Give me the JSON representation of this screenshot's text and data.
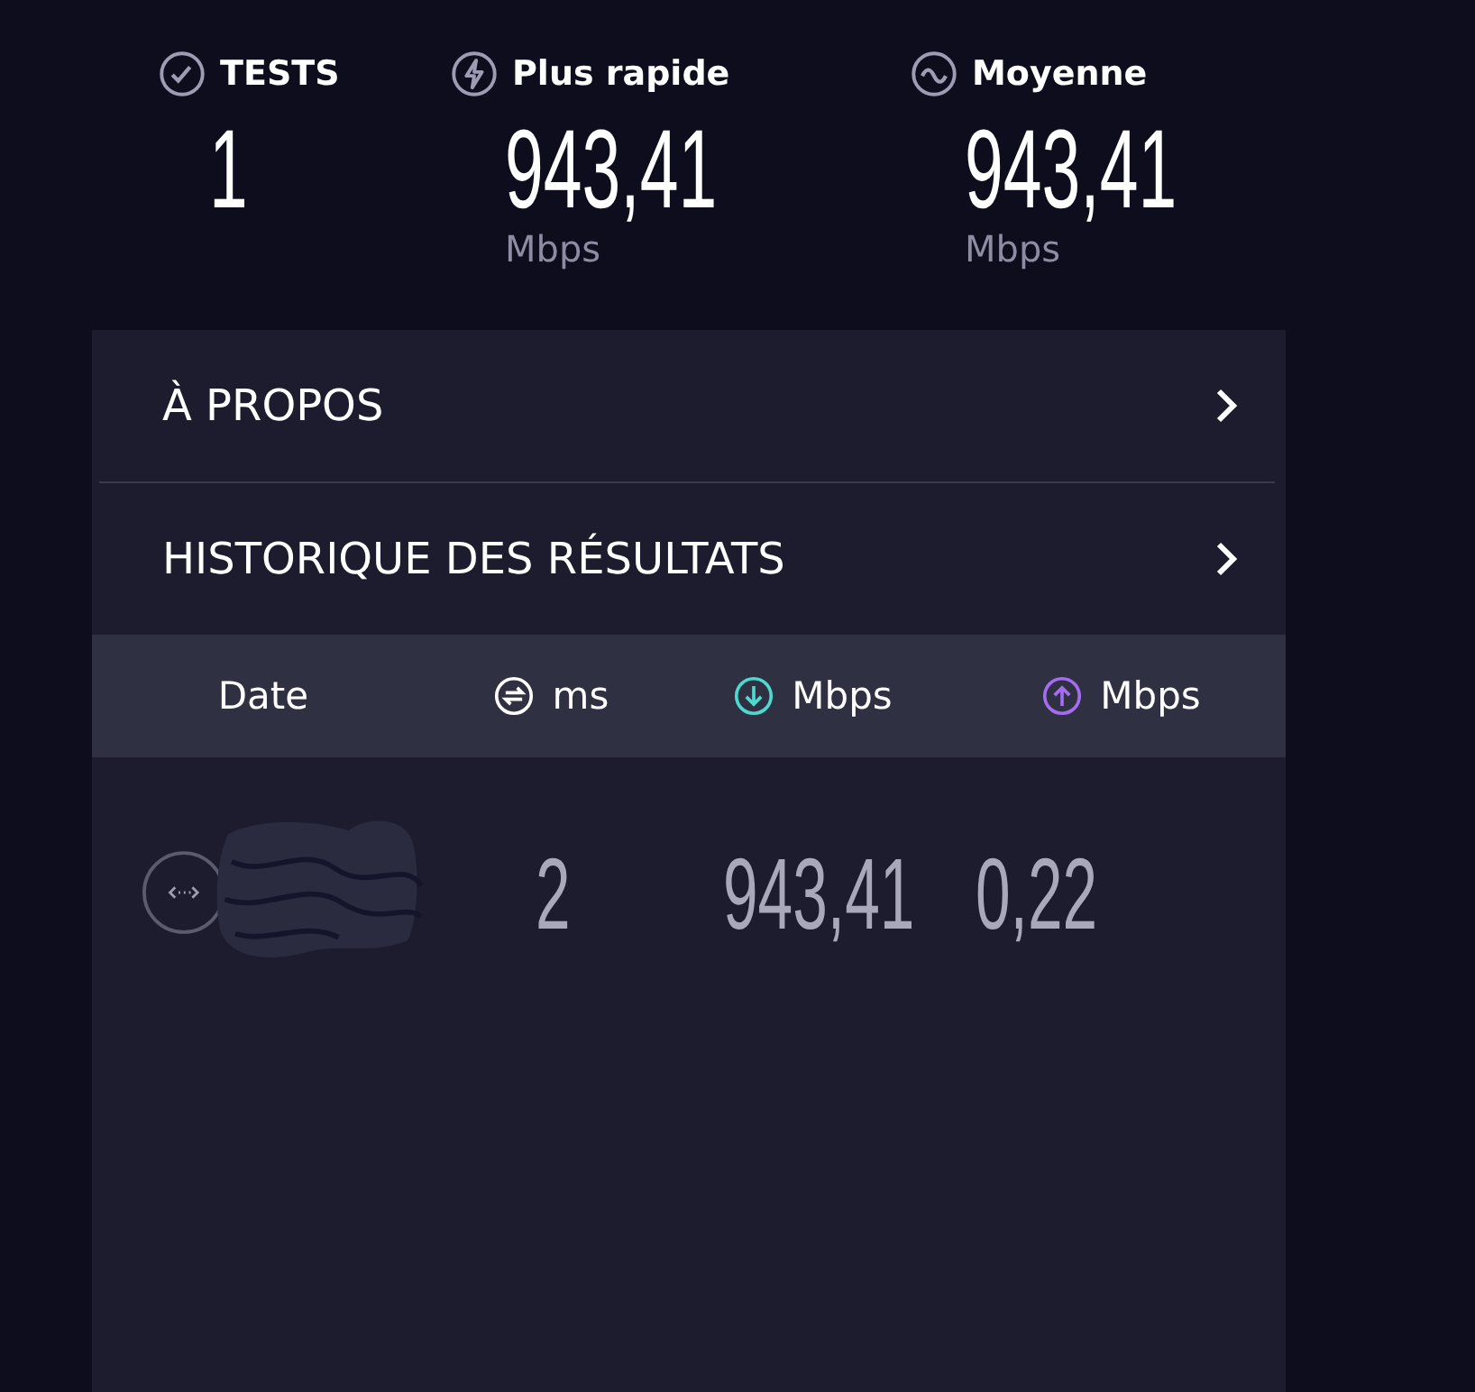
{
  "stats": [
    {
      "kind": "tests",
      "label": "TESTS",
      "value": "1"
    },
    {
      "kind": "fastest",
      "label": "Plus rapide",
      "value": "943,41",
      "unit": "Mbps"
    },
    {
      "kind": "average",
      "label": "Moyenne",
      "value": "943,41",
      "unit": "Mbps"
    }
  ],
  "menu": [
    {
      "label": "À PROPOS"
    },
    {
      "label": "HISTORIQUE DES RÉSULTATS"
    }
  ],
  "history": {
    "columns": [
      {
        "kind": "date",
        "label": "Date"
      },
      {
        "kind": "ping",
        "label": "ms"
      },
      {
        "kind": "download",
        "label": "Mbps"
      },
      {
        "kind": "upload",
        "label": "Mbps"
      }
    ],
    "rows": [
      {
        "ping": "2",
        "download": "943,41",
        "upload": "0,22"
      }
    ]
  }
}
